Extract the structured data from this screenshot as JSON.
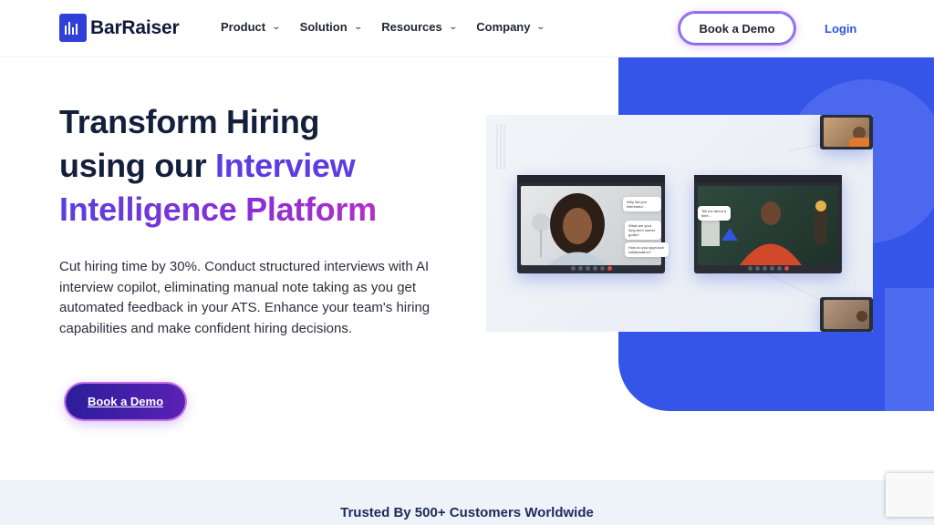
{
  "brand": {
    "name": "BarRaiser",
    "accent": "#2f3fd9",
    "purple": "#5b21b6"
  },
  "nav": {
    "items": [
      {
        "label": "Product",
        "icon": "chevron-down-icon"
      },
      {
        "label": "Solution",
        "icon": "chevron-down-icon"
      },
      {
        "label": "Resources",
        "icon": "chevron-down-icon"
      },
      {
        "label": "Company",
        "icon": "chevron-down-icon"
      }
    ],
    "cta_label": "Book a Demo",
    "login_label": "Login"
  },
  "hero": {
    "title_line1": "Transform Hiring",
    "title_line2_plain": "using our ",
    "title_line2_accent": "Interview",
    "title_line3_accent": "Intelligence Platform",
    "description": "Cut hiring time by 30%. Conduct structured interviews with AI interview copilot, eliminating manual note taking as you get automated feedback in your ATS. Enhance your team's hiring capabilities and make confident hiring decisions.",
    "cta_label": "Book a Demo"
  },
  "trusted": {
    "text": "Trusted By 500+ Customers Worldwide"
  }
}
